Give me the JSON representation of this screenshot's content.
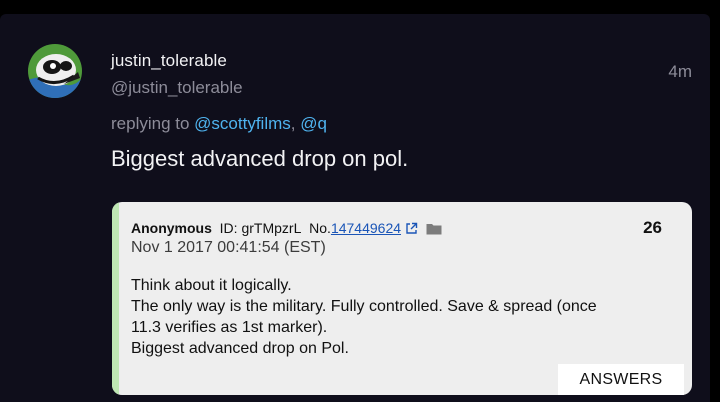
{
  "tweet": {
    "author_name": "justin_tolerable",
    "author_handle": "@justin_tolerable",
    "time": "4m",
    "reply_prefix": "replying to",
    "mention_1": "@scottyfilms",
    "mention_sep": ",",
    "mention_2": "@q",
    "text": "Biggest advanced drop on pol."
  },
  "quote": {
    "author": "Anonymous",
    "id_label": "ID:",
    "id_value": "grTMpzrL",
    "no_label": "No.",
    "post_number": "147449624",
    "reply_count": "26",
    "date": "Nov 1 2017 00:41:54 (EST)",
    "lines": [
      "Think about it logically.",
      "The only way is the military. Fully controlled. Save & spread (once",
      "11.3 verifies as 1st marker).",
      "Biggest advanced drop on Pol."
    ],
    "answers_label": "ANSWERS"
  },
  "colors": {
    "background": "#0f0e1b",
    "mention": "#4fb3ef",
    "muted_text": "#8d8c99",
    "quote_bg": "#eeeeee",
    "quote_accent": "#bfe7b4",
    "post_link": "#1a55b7"
  },
  "icons": {
    "avatar": "avatar-image",
    "external_link": "external-link-icon",
    "folder": "folder-icon"
  }
}
